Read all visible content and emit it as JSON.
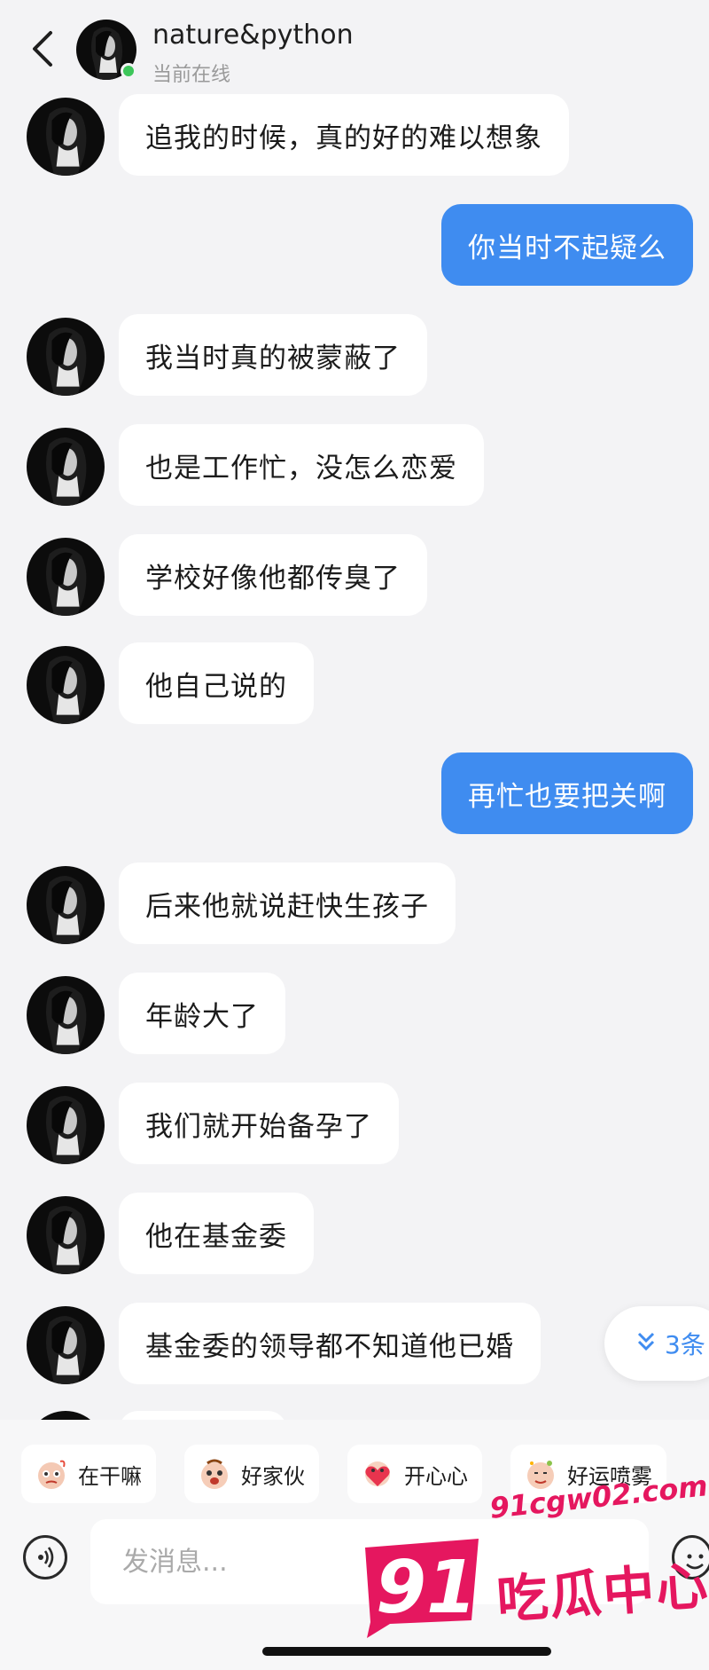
{
  "header": {
    "contact_name": "nature&python",
    "status": "当前在线",
    "online_color": "#3dc65a"
  },
  "messages": [
    {
      "side": "in",
      "text": "追我的时候，真的好的难以想象"
    },
    {
      "side": "out",
      "text": "你当时不起疑么"
    },
    {
      "side": "in",
      "text": "我当时真的被蒙蔽了"
    },
    {
      "side": "in",
      "text": "也是工作忙，没怎么恋爱"
    },
    {
      "side": "in",
      "text": "学校好像他都传臭了"
    },
    {
      "side": "in",
      "text": "他自己说的"
    },
    {
      "side": "out",
      "text": "再忙也要把关啊"
    },
    {
      "side": "in",
      "text": "后来他就说赶快生孩子"
    },
    {
      "side": "in",
      "text": "年龄大了"
    },
    {
      "side": "in",
      "text": "我们就开始备孕了"
    },
    {
      "side": "in",
      "text": "他在基金委"
    },
    {
      "side": "in",
      "text": "基金委的领导都不知道他已婚"
    }
  ],
  "unread": {
    "label": "3条"
  },
  "quick_replies": [
    {
      "label": "在干嘛",
      "icon": "sticker-wondering-icon"
    },
    {
      "label": "好家伙",
      "icon": "sticker-surprised-icon"
    },
    {
      "label": "开心心",
      "icon": "sticker-heart-icon"
    },
    {
      "label": "好运喷雾",
      "icon": "sticker-lucky-icon"
    }
  ],
  "composer": {
    "placeholder": "发消息..."
  },
  "watermark": {
    "url": "91cgw02.com",
    "number": "91",
    "text": "吃瓜中心"
  },
  "colors": {
    "outgoing_bubble": "#3f8cf0",
    "incoming_bubble": "#ffffff",
    "background": "#f3f3f5",
    "watermark": "#e5175f"
  }
}
